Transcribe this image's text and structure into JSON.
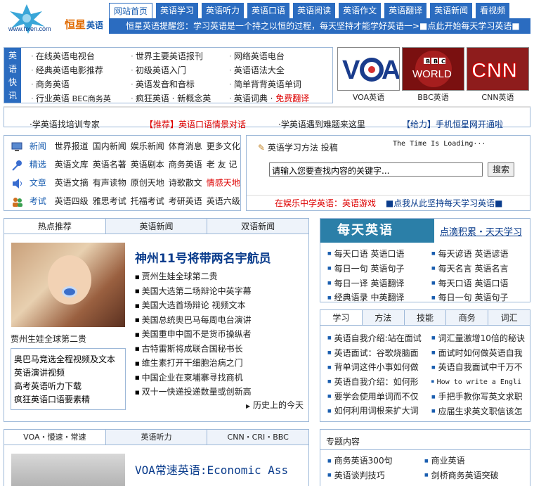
{
  "logo": {
    "url_text": "www.hxen.com",
    "brand": "恒星",
    "brand_suffix": "英语"
  },
  "nav": [
    "网站首页",
    "英语学习",
    "英语听力",
    "英语口语",
    "英语阅读",
    "英语作文",
    "英语翻译",
    "英语新闻",
    "看视频"
  ],
  "notice": "恒星英语提醒您：学习英语是一个持之以恒的过程，每天坚持才能学好英语一>■点此开始每天学习英语■",
  "quick": {
    "side": [
      "英",
      "语",
      "快",
      "讯"
    ],
    "col1": [
      "在线英语电视台",
      "经典英语电影推荐",
      "商务英语"
    ],
    "col1_last": [
      "行业英语",
      "BEC商务英"
    ],
    "col2": [
      "世界主要英语报刊",
      "初级英语入门",
      "英语发音和音标"
    ],
    "col2_last": [
      "疯狂英语",
      "新概念英"
    ],
    "col3": [
      "网络英语电台",
      "英语语法大全",
      "简单背背英语单词"
    ],
    "col3_last": [
      "英语词典",
      "免费翻译"
    ]
  },
  "media": [
    "VOA英语",
    "BBC英语",
    "CNN英语"
  ],
  "ticker": [
    "·学英语找培训专家",
    "【推荐】英语口语情景对话",
    "·学英语遇到难题来这里",
    "【给力】手机恒星网开通啦"
  ],
  "categories": [
    {
      "label": "新闻",
      "items": [
        "世界报道",
        "国内新闻",
        "娱乐新闻",
        "体育消息",
        "更多文化"
      ]
    },
    {
      "label": "精选",
      "items": [
        "英语文库",
        "英语名著",
        "英语剧本",
        "商务英语",
        "老 友 记"
      ]
    },
    {
      "label": "文章",
      "items": [
        "英语文摘",
        "有声读物",
        "原创天地",
        "诗歌散文",
        "情感天地"
      ]
    },
    {
      "label": "考试",
      "items": [
        "英语四级",
        "雅思考试",
        "托福考试",
        "考研英语",
        "英语六级"
      ]
    }
  ],
  "search": {
    "title": "英语学习方法",
    "post": "投稿",
    "time": "The Time Is Loading···",
    "placeholder": "请输入您要查找内容的关键字...",
    "button": "搜索",
    "foot_left": "在娱乐中学英语：英语游戏",
    "foot_right": "■点我从此坚持每天学习英语■"
  },
  "hot": {
    "tabs": [
      "热点推荐",
      "英语新闻",
      "双语新闻"
    ],
    "caption": "贾州生娃全球第二贵",
    "mini": [
      "奥巴马竞选全程视频及文本",
      "英语演讲视频",
      "高考英语听力下载",
      "疯狂英语口语要素精"
    ],
    "headline": "神州11号将带两名宇航员",
    "items": [
      "贾州生娃全球第二贵",
      "美国大选第二场辩论中英字幕",
      "美国大选首场辩论 视频文本",
      "美国总统奥巴马每周电台演讲",
      "美国重申中国不是货币操纵者",
      "古特雷斯将成联合国秘书长",
      "维生素打开干细胞治病之门",
      "中国企业在柬埔寨寻找商机",
      "双十一快递投递数量或创新高"
    ],
    "more": "历史上的今天"
  },
  "daily": {
    "title": "每天英语",
    "subtitle": "点滴积累・天天学习",
    "left": [
      "每天口语 英语口语",
      "每日一句 英语句子",
      "每日一译 英语翻译",
      "经典语录 中英翻译"
    ],
    "right": [
      "每天谚语 英语谚语",
      "每天名言 英语名言",
      "每天口语 英语口语",
      "每日一句 英语句子"
    ]
  },
  "learn": {
    "tabs": [
      "学习",
      "方法",
      "技能",
      "商务",
      "词汇"
    ],
    "left": [
      "英语自我介绍:站在面试",
      "英语面试：谷歌烧脑面",
      "背单词这件小事如何做",
      "英语自我介绍：如何形",
      "要学会使用单词而不仅",
      "如何利用词根来扩大词"
    ],
    "right": [
      "词汇量激增10倍的秘诀",
      "面试时如何做英语自我",
      "英语自我面试中千万不",
      "How to write a Engli",
      "手把手教你写英文求职",
      "应届生求英文职信该怎"
    ]
  },
  "voa": {
    "tabs": [
      "VOA・慢速・常速",
      "英语听力",
      "CNN・CRI・BBC"
    ],
    "headline": "VOA常速英语:Economic Ass"
  },
  "special": {
    "title": "专题内容",
    "left": [
      "商务英语300句",
      "英语谈判技巧"
    ],
    "right": [
      "商业英语",
      "剑桥商务英语突破"
    ]
  },
  "colors": {
    "brand_blue": "#2b6cc0",
    "link_red": "#dd0000"
  }
}
